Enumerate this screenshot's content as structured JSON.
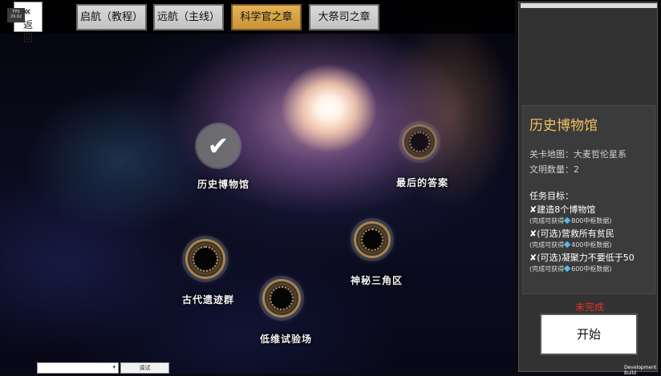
{
  "top_bar": {
    "back_label": "返回",
    "fps_text": "FPS 29.92",
    "tabs": [
      {
        "label": "启航（教程）",
        "active": false
      },
      {
        "label": "远航（主线）",
        "active": false
      },
      {
        "label": "科学官之章",
        "active": true
      },
      {
        "label": "大祭司之章",
        "active": false
      }
    ]
  },
  "stages": [
    {
      "label": "历史博物馆",
      "state": "completed",
      "icon": "checkmark-icon"
    },
    {
      "label": "最后的答案",
      "state": "locked",
      "icon": "portal-ring-icon"
    },
    {
      "label": "神秘三角区",
      "state": "locked",
      "icon": "portal-ring-icon"
    },
    {
      "label": "古代遗迹群",
      "state": "locked",
      "icon": "portal-ring-icon"
    },
    {
      "label": "低维试验场",
      "state": "locked",
      "icon": "portal-ring-icon"
    }
  ],
  "debug": {
    "dropdown_value": "",
    "button_label": "调试"
  },
  "panel": {
    "title": "历史博物馆",
    "map_line": "关卡地图：大麦哲伦星系",
    "civ_line": "文明数量：2",
    "objectives_heading": "任务目标：",
    "objectives": [
      {
        "mark": "✘",
        "text": "建造8个博物馆",
        "reward_prefix": "(完成可获得",
        "reward_suffix": "800中枢数据)"
      },
      {
        "mark": "✘",
        "text": "(可选)营救所有贫民",
        "reward_prefix": "(完成可获得",
        "reward_suffix": "400中枢数据)"
      },
      {
        "mark": "✘",
        "text": "(可选)凝聚力不要低于50",
        "reward_prefix": "(完成可获得",
        "reward_suffix": "600中枢数据)"
      }
    ],
    "status": "未完成",
    "start_label": "开始"
  },
  "dev_build_text": "Development Build",
  "colors": {
    "active_tab": "#d9a548",
    "title_gold": "#f0c060",
    "status_red": "#e83030",
    "gem_blue": "#58b8ee"
  }
}
